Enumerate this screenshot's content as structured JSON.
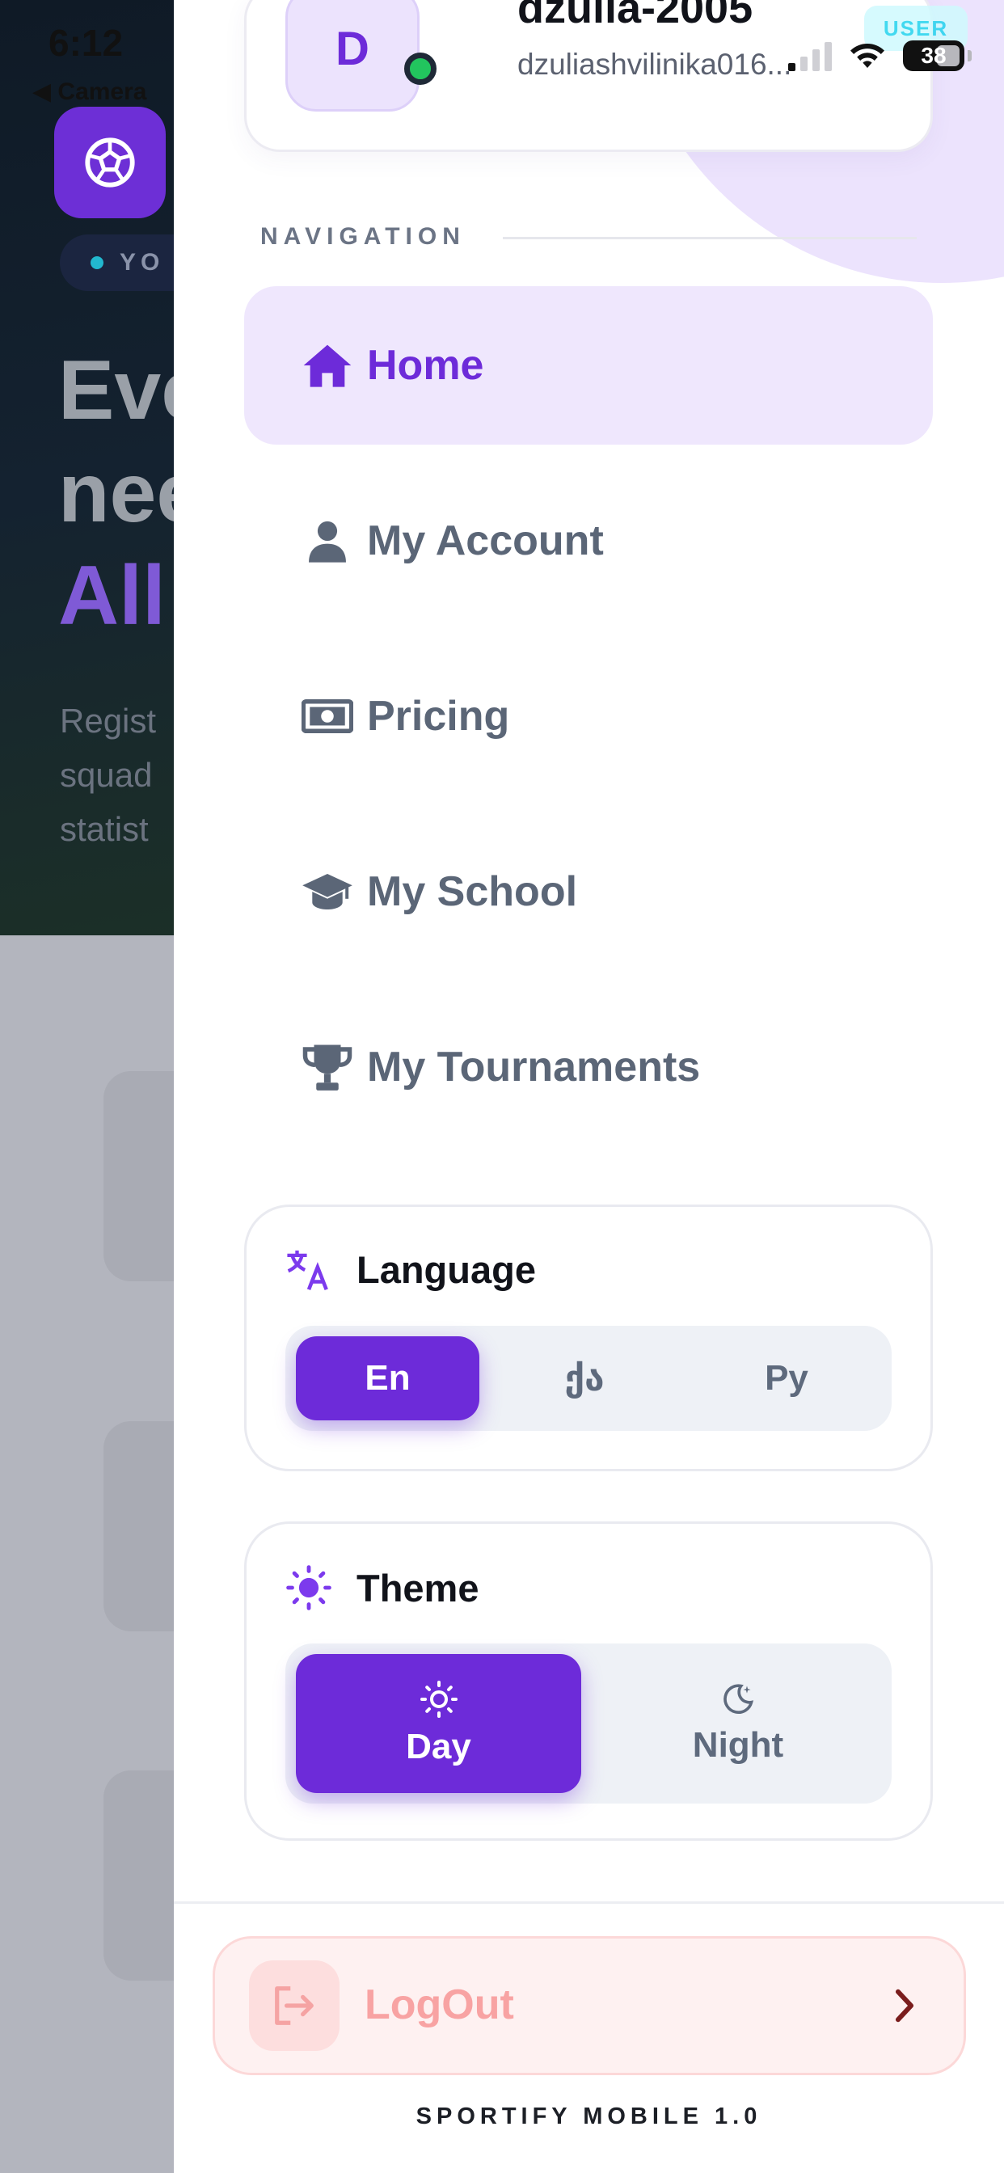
{
  "status_bar": {
    "time": "6:12",
    "back_label": "◀ Camera",
    "battery": "38"
  },
  "background": {
    "badge": "YO",
    "heading_lines": [
      "Eve",
      "nee",
      "All"
    ],
    "subtext_lines": [
      "Regist",
      "squad",
      "statist"
    ]
  },
  "profile": {
    "avatar_letter": "D",
    "username": "dzulia-2005",
    "email": "dzuliashvilinika016...",
    "role": "USER"
  },
  "navigation": {
    "heading": "NAVIGATION",
    "items": [
      {
        "label": "Home",
        "icon": "home-icon",
        "active": true
      },
      {
        "label": "My Account",
        "icon": "user-icon",
        "active": false
      },
      {
        "label": "Pricing",
        "icon": "money-icon",
        "active": false
      },
      {
        "label": "My School",
        "icon": "graduation-cap-icon",
        "active": false
      },
      {
        "label": "My Tournaments",
        "icon": "trophy-icon",
        "active": false
      }
    ]
  },
  "language": {
    "title": "Language",
    "options": [
      "En",
      "ქა",
      "Ру"
    ],
    "selected": "En"
  },
  "theme": {
    "title": "Theme",
    "options": [
      "Day",
      "Night"
    ],
    "selected": "Day"
  },
  "logout": {
    "label": "LogOut"
  },
  "footer": {
    "version": "SPORTIFY MOBILE 1.0"
  },
  "colors": {
    "accent": "#6d2bd9",
    "accent_light": "#efe7fd",
    "muted": "#5b6677",
    "danger_soft": "#f8a3a3"
  }
}
